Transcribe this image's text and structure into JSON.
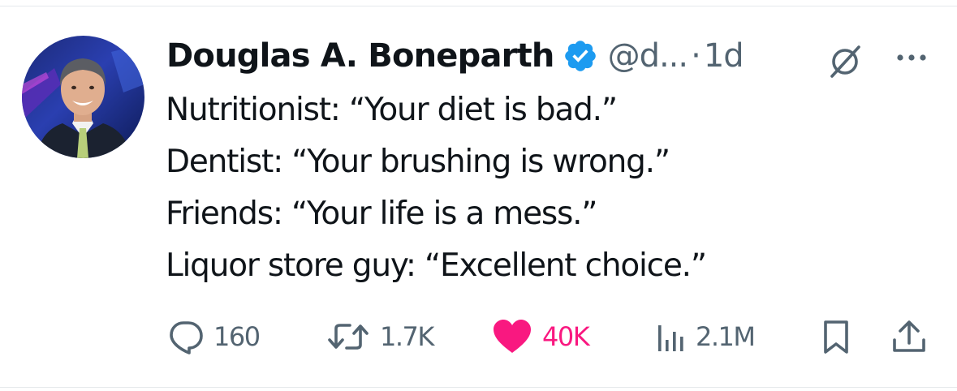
{
  "tweet": {
    "author": {
      "display_name": "Douglas A. Boneparth",
      "handle": "@d...",
      "verified": true
    },
    "separator": "·",
    "timestamp": "1d",
    "lines": [
      "Nutritionist: “Your diet is bad.”",
      "Dentist: “Your brushing is wrong.”",
      "Friends: “Your life is a mess.”",
      "Liquor store guy: “Excellent choice.”"
    ]
  },
  "header_icons": {
    "grok": "grok-slash-icon",
    "more": "more-horizontal-icon"
  },
  "actions": {
    "replies": "160",
    "reposts": "1.7K",
    "likes": "40K",
    "views": "2.1M",
    "liked": true
  },
  "colors": {
    "text_primary": "#0f1419",
    "text_secondary": "#536471",
    "verified_blue": "#1d9bf0",
    "like_pink": "#f91880"
  }
}
